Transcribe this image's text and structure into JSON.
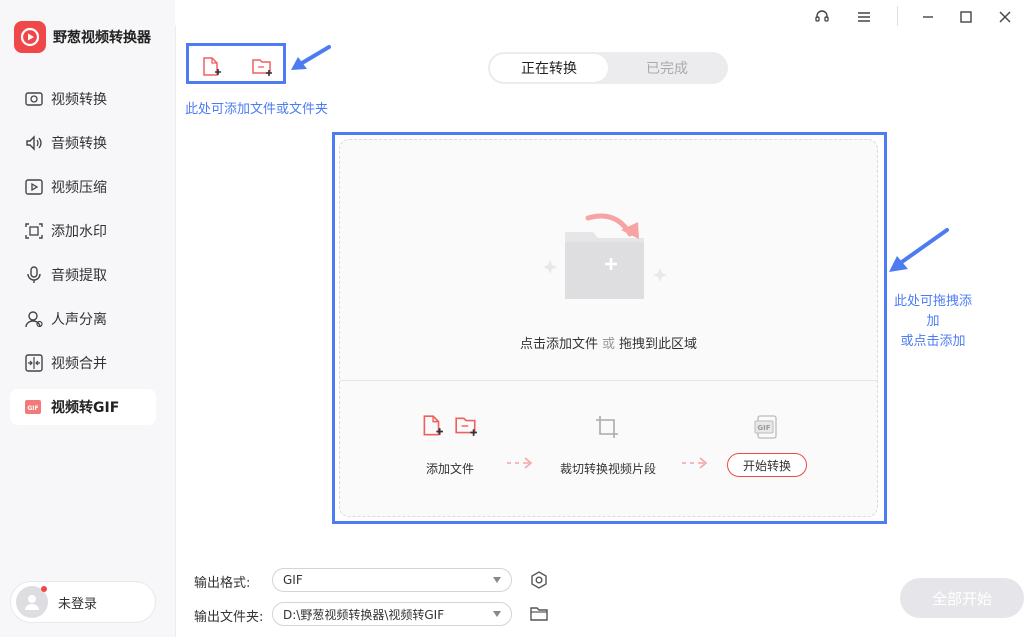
{
  "app": {
    "name": "野葱视频转换器"
  },
  "sidebar": {
    "items": [
      {
        "label": "视频转换",
        "icon": "video-convert-icon"
      },
      {
        "label": "音频转换",
        "icon": "audio-convert-icon"
      },
      {
        "label": "视频压缩",
        "icon": "video-compress-icon"
      },
      {
        "label": "添加水印",
        "icon": "watermark-icon"
      },
      {
        "label": "音频提取",
        "icon": "audio-extract-icon"
      },
      {
        "label": "人声分离",
        "icon": "vocal-separate-icon"
      },
      {
        "label": "视频合并",
        "icon": "video-merge-icon"
      },
      {
        "label": "视频转GIF",
        "icon": "gif-icon",
        "active": true
      }
    ],
    "login_label": "未登录"
  },
  "annotations": {
    "top_hint": "此处可添加文件或文件夹",
    "right_hint_line1": "此处可拖拽添加",
    "right_hint_line2": "或点击添加"
  },
  "tabs": [
    {
      "label": "正在转换",
      "active": true
    },
    {
      "label": "已完成",
      "active": false
    }
  ],
  "dropzone": {
    "text_main": "点击添加文件",
    "text_or": "或",
    "text_drag": "拖拽到此区域",
    "steps": {
      "add": "添加文件",
      "crop": "裁切转换视频片段",
      "start": "开始转换"
    }
  },
  "bottom": {
    "format_label": "输出格式:",
    "format_value": "GIF",
    "folder_label": "输出文件夹:",
    "folder_value": "D:\\野葱视频转换器\\视频转GIF",
    "start_all": "全部开始"
  },
  "colors": {
    "brand": "#f04848",
    "annotation": "#4d7cf2",
    "sidebar_bg": "#f7f7f9",
    "disabled_button": "#e6e6ea"
  }
}
